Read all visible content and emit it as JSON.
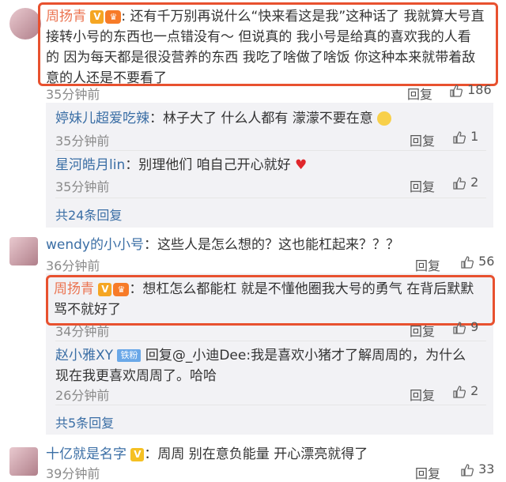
{
  "comments": [
    {
      "user": "周扬青",
      "colon": ":",
      "text_lines": [
        "还有千万别再说什么“快来看这是我”这种话了 我就算大号直",
        "接转小号的东西也一点错没有～ 但说真的 我小号是给真的喜欢我的人看",
        "的 因为每天都是很没营养的东西 我吃了啥做了啥饭 你这种本来就带着敌",
        "意的人还是不要看了"
      ],
      "time": "35分钟前",
      "reply_label": "回复",
      "likes": "186"
    }
  ],
  "sub_replies_1": [
    {
      "user": "婷妹儿超爱吃辣",
      "text": "：林子大了 什么人都有 濛濛不要在意",
      "time": "35分钟前",
      "reply_label": "回复",
      "likes": "1"
    },
    {
      "user": "星河皓月lin",
      "text": "：别理他们 咱自己开心就好",
      "time": "35分钟前",
      "reply_label": "回复",
      "likes": "2"
    }
  ],
  "more_1": "共24条回复",
  "comment2": {
    "user": "wendy的小小号",
    "text": "：这些人是怎么想的？这也能杠起来？？？",
    "time": "36分钟前",
    "reply_label": "回复",
    "likes": "56"
  },
  "sub_replies_2": [
    {
      "user": "周扬青",
      "text_lines": [
        "：想杠怎么都能杠 就是不懂他圈我大号的勇气 在背后默默",
        "骂不就好了"
      ],
      "time": "34分钟前",
      "reply_label": "回复",
      "likes": "9"
    },
    {
      "user": "赵小雅XY",
      "badge": "铁粉",
      "text_lines": [
        "回复@_小迪Dee:我是喜欢小猪才了解周周的，为什么",
        "现在我更喜欢周周了。哈哈"
      ],
      "time": "26分钟前",
      "reply_label": "回复",
      "likes": "2"
    }
  ],
  "more_2": "共5条回复",
  "comment3": {
    "user": "十亿就是名字",
    "text": "：周周 别在意负能量 开心漂亮就得了",
    "time": "39分钟前",
    "reply_label": "回复",
    "likes": "33"
  },
  "icons": {
    "verified": "verified-v-icon",
    "crown": "crown-badge-icon",
    "emoji_pleading": "pleading-face-icon",
    "emoji_heart": "red-heart-icon",
    "thumb": "thumbs-up-icon"
  },
  "colors": {
    "username": "#eb7350",
    "link": "#3a6ea5",
    "highlight_box": "#e8512f",
    "reply_bg": "#f2f2f5"
  }
}
